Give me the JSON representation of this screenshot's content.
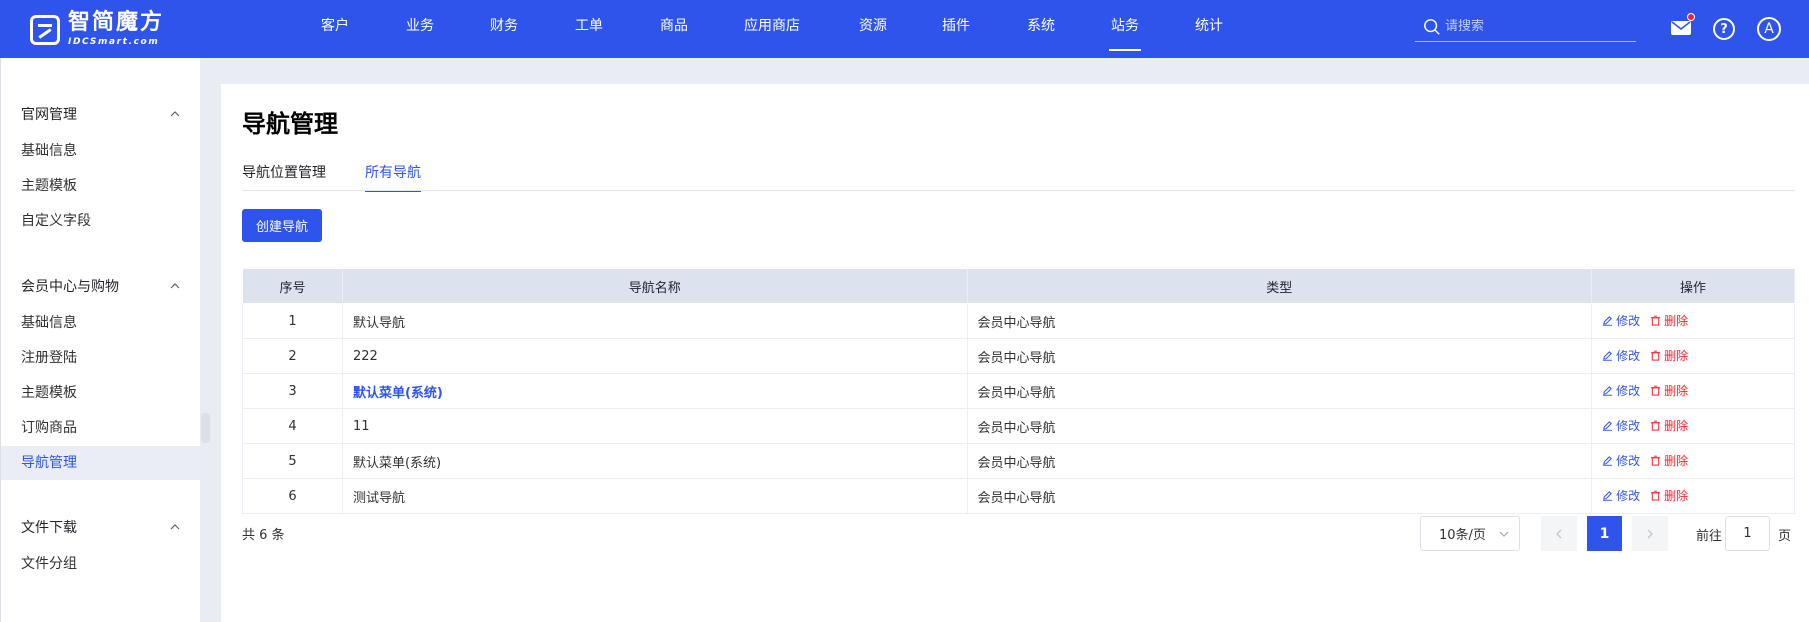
{
  "app": {
    "logo_cn": "智简魔方",
    "logo_en": "IDCSmart.com"
  },
  "topnav": {
    "items": [
      "客户",
      "业务",
      "财务",
      "工单",
      "商品",
      "应用商店",
      "资源",
      "插件",
      "系统",
      "站务",
      "统计"
    ],
    "active": "站务",
    "search_placeholder": "请搜索",
    "help_label": "?",
    "avatar_label": "A"
  },
  "sidebar": {
    "groups": [
      {
        "label": "官网管理",
        "items": [
          "基础信息",
          "主题模板",
          "自定义字段"
        ]
      },
      {
        "label": "会员中心与购物",
        "items": [
          "基础信息",
          "注册登陆",
          "主题模板",
          "订购商品",
          "导航管理"
        ]
      },
      {
        "label": "文件下载",
        "items": [
          "文件分组"
        ]
      }
    ],
    "active_item": "导航管理"
  },
  "main": {
    "title": "导航管理",
    "tabs": [
      "导航位置管理",
      "所有导航"
    ],
    "active_tab": "所有导航",
    "create_button": "创建导航",
    "table": {
      "headers": [
        "序号",
        "导航名称",
        "类型",
        "操作"
      ],
      "rows": [
        {
          "no": "1",
          "name": "默认导航",
          "type": "会员中心导航",
          "bold": false
        },
        {
          "no": "2",
          "name": "222",
          "type": "会员中心导航",
          "bold": false
        },
        {
          "no": "3",
          "name": "默认菜单(系统)",
          "type": "会员中心导航",
          "bold": true
        },
        {
          "no": "4",
          "name": "11",
          "type": "会员中心导航",
          "bold": false
        },
        {
          "no": "5",
          "name": "默认菜单(系统)",
          "type": "会员中心导航",
          "bold": false
        },
        {
          "no": "6",
          "name": "测试导航",
          "type": "会员中心导航",
          "bold": false
        }
      ],
      "edit_label": "修改",
      "delete_label": "删除"
    },
    "pagination": {
      "total_text": "共 6 条",
      "page_size": "10条/页",
      "current_page": "1",
      "goto_prefix": "前往",
      "goto_value": "1",
      "goto_suffix": "页"
    }
  },
  "colors": {
    "primary": "#2f54eb",
    "danger": "#f5222d",
    "table_header": "#dde3ee"
  }
}
